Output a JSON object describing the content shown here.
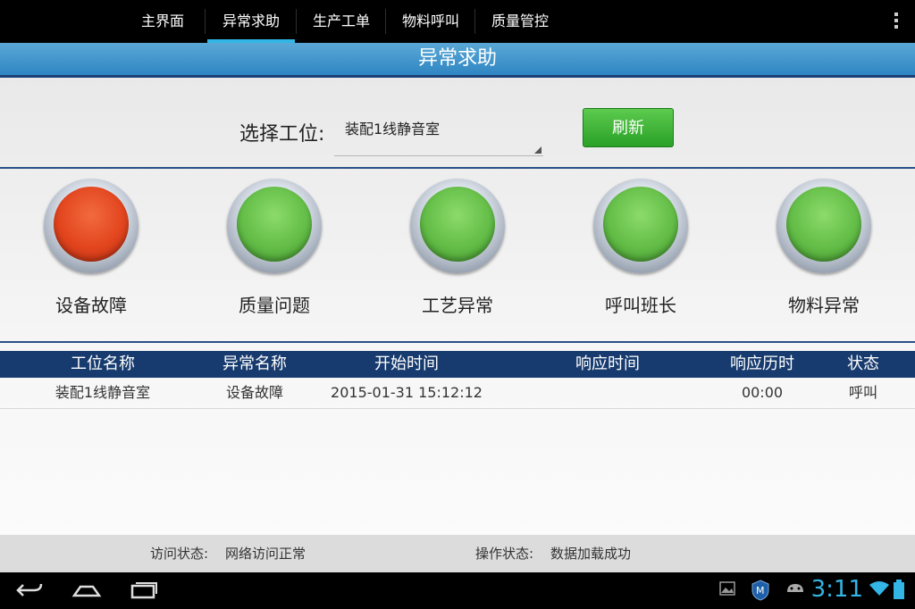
{
  "tabs": [
    {
      "label": "主界面"
    },
    {
      "label": "异常求助"
    },
    {
      "label": "生产工单"
    },
    {
      "label": "物料呼叫"
    },
    {
      "label": "质量管控"
    }
  ],
  "title": "异常求助",
  "selector": {
    "label": "选择工位:",
    "value": "装配1线静音室"
  },
  "refresh_label": "刷新",
  "call_buttons": [
    {
      "label": "设备故障",
      "state": "red"
    },
    {
      "label": "质量问题",
      "state": "green"
    },
    {
      "label": "工艺异常",
      "state": "green"
    },
    {
      "label": "呼叫班长",
      "state": "green"
    },
    {
      "label": "物料异常",
      "state": "green"
    }
  ],
  "table": {
    "headers": [
      "工位名称",
      "异常名称",
      "开始时间",
      "响应时间",
      "响应历时",
      "状态"
    ],
    "rows": [
      [
        "装配1线静音室",
        "设备故障",
        "2015-01-31 15:12:12",
        "",
        "00:00",
        "呼叫"
      ]
    ]
  },
  "status": {
    "access_label": "访问状态:",
    "access_value": "网络访问正常",
    "op_label": "操作状态:",
    "op_value": "数据加载成功"
  },
  "system": {
    "clock": "3:11"
  },
  "colors": {
    "accent": "#33b5e5",
    "title_bar": "#2f86c3",
    "table_header": "#173b6e",
    "alarm_red": "#e2451e",
    "ok_green": "#63bd47"
  }
}
